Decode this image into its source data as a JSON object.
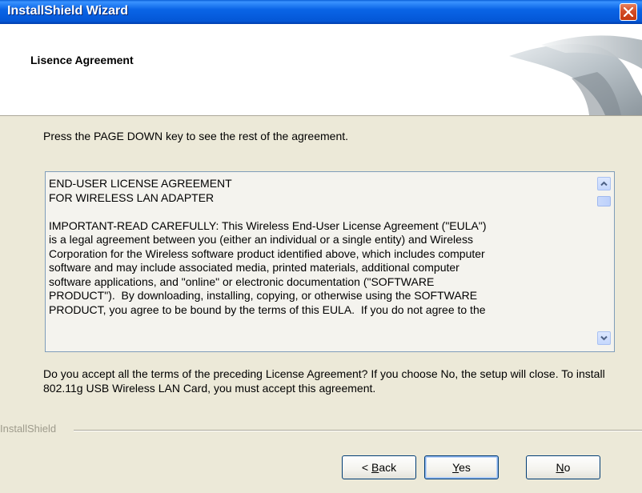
{
  "window": {
    "title": "InstallShield Wizard"
  },
  "header": {
    "title": "Lisence Agreement"
  },
  "instruction": "Press the PAGE DOWN key to see the rest of the agreement.",
  "eula": {
    "text": "END-USER LICENSE AGREEMENT\nFOR WIRELESS LAN ADAPTER\n\nIMPORTANT-READ CAREFULLY: This Wireless End-User License Agreement (\"EULA\")\nis a legal agreement between you (either an individual or a single entity) and Wireless\nCorporation for the Wireless software product identified above, which includes computer\nsoftware and may include associated media, printed materials, additional computer\nsoftware applications, and \"online\" or electronic documentation (\"SOFTWARE\nPRODUCT\").  By downloading, installing, copying, or otherwise using the SOFTWARE\nPRODUCT, you agree to be bound by the terms of this EULA.  If you do not agree to the"
  },
  "question": "Do you accept all the terms of the preceding License Agreement?  If you choose No,  the setup will close.  To install 802.11g USB Wireless LAN Card, you must accept this agreement.",
  "brand": "InstallShield",
  "buttons": {
    "back": {
      "prefix": "< ",
      "accel": "B",
      "rest": "ack"
    },
    "yes": {
      "accel": "Y",
      "rest": "es"
    },
    "no": {
      "accel": "N",
      "rest": "o"
    }
  },
  "icons": {
    "close": "close-icon",
    "scroll_up": "chevron-up-icon",
    "scroll_down": "chevron-down-icon",
    "header_graphic": "wizard-graphic-icon"
  },
  "colors": {
    "titlebar": "#0a5fd8",
    "dialog_bg": "#ece9d8",
    "close_button": "#d34d27"
  }
}
